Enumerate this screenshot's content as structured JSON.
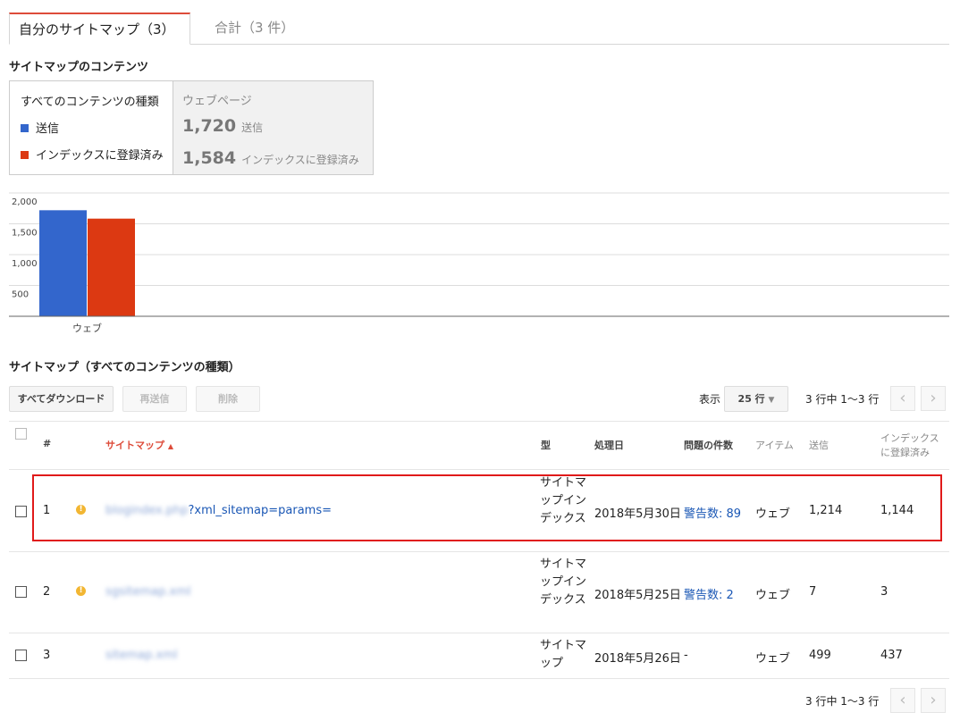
{
  "tabs": [
    {
      "label": "自分のサイトマップ（3）"
    },
    {
      "label": "合計（3 件）"
    }
  ],
  "content_section_title": "サイトマップのコンテンツ",
  "legend": {
    "heading": "すべてのコンテンツの種類",
    "items": [
      {
        "label": "送信",
        "color": "#3366cc"
      },
      {
        "label": "インデックスに登録済み",
        "color": "#dc3912"
      }
    ]
  },
  "stats": {
    "heading": "ウェブページ",
    "submitted_value": "1,720",
    "submitted_label": "送信",
    "indexed_value": "1,584",
    "indexed_label": "インデックスに登録済み"
  },
  "chart_data": {
    "type": "bar",
    "categories": [
      "ウェブ"
    ],
    "series": [
      {
        "name": "送信",
        "values": [
          1720
        ],
        "color": "#3366cc"
      },
      {
        "name": "インデックスに登録済み",
        "values": [
          1584
        ],
        "color": "#dc3912"
      }
    ],
    "yticks": [
      "2,000",
      "1,500",
      "1,000",
      "500"
    ],
    "ytick_values": [
      2000,
      1500,
      1000,
      500
    ],
    "ylim": [
      0,
      2000
    ],
    "grid": true
  },
  "table_section_title": "サイトマップ（すべてのコンテンツの種類）",
  "toolbar": {
    "download_all": "すべてダウンロード",
    "resubmit": "再送信",
    "delete": "削除",
    "show_label": "表示",
    "rows_select": "25 行",
    "range_text": "3 行中 1〜3 行"
  },
  "table": {
    "headers": {
      "num": "#",
      "sitemap": "サイトマップ",
      "type": "型",
      "processed": "処理日",
      "issues": "問題の件数",
      "item": "アイテム",
      "submitted": "送信",
      "indexed_line1": "インデックス",
      "indexed_line2": "に登録済み"
    },
    "rows": [
      {
        "num": "1",
        "sitemap_blur": "blogindex.php",
        "sitemap_visible": "?xml_sitemap=params=",
        "type": "サイトマップインデックス",
        "processed": "2018年5月30日",
        "issues": "警告数: 89",
        "item": "ウェブ",
        "submitted": "1,214",
        "indexed": "1,144"
      },
      {
        "num": "2",
        "sitemap_blur": "sgsitemap.xml",
        "sitemap_visible": "",
        "type": "サイトマップインデックス",
        "processed": "2018年5月25日",
        "issues": "警告数: 2",
        "item": "ウェブ",
        "submitted": "7",
        "indexed": "3"
      },
      {
        "num": "3",
        "sitemap_blur": "sitemap.xml",
        "sitemap_visible": "",
        "type": "サイトマップ",
        "processed": "2018年5月26日",
        "issues": "-",
        "item": "ウェブ",
        "submitted": "499",
        "indexed": "437"
      }
    ]
  },
  "footer_range_text": "3 行中 1〜3 行"
}
